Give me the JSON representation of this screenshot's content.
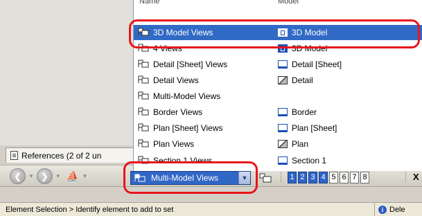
{
  "dropdown": {
    "header_name": "Name",
    "header_model": "Model",
    "rows": [
      {
        "name": "3D Model Views",
        "model": "3D Model",
        "model_icon": "3d-model-icon"
      },
      {
        "name": "4 Views",
        "model": "3D Model",
        "model_icon": "3d-model-icon"
      },
      {
        "name": "Detail [Sheet] Views",
        "model": "Detail [Sheet]",
        "model_icon": "sheet-icon"
      },
      {
        "name": "Detail Views",
        "model": "Detail",
        "model_icon": "detail-icon"
      },
      {
        "name": "Multi-Model Views",
        "model": "",
        "model_icon": ""
      },
      {
        "name": "Border Views",
        "model": "Border",
        "model_icon": "sheet-icon"
      },
      {
        "name": "Plan [Sheet] Views",
        "model": "Plan [Sheet]",
        "model_icon": "sheet-icon"
      },
      {
        "name": "Plan Views",
        "model": "Plan",
        "model_icon": "detail-icon"
      },
      {
        "name": "Section 1 Views",
        "model": "Section 1",
        "model_icon": "sheet-icon"
      }
    ],
    "selected_index": 0
  },
  "references_tab": {
    "label": "References (2 of 2 un"
  },
  "toolbar": {
    "view_combo": {
      "value": "Multi-Model Views"
    },
    "back_glyph": "❮",
    "forward_glyph": "❯",
    "view_numbers": [
      "1",
      "2",
      "3",
      "4",
      "5",
      "6",
      "7",
      "8"
    ],
    "active_views": [
      "1",
      "2",
      "3",
      "4"
    ],
    "close_glyph": "X"
  },
  "status_bar": {
    "message": "Element Selection > Identify element to add to set",
    "right_text": "Dele",
    "info_glyph": "i"
  },
  "colors": {
    "selection": "#316ac5",
    "highlight_ring": "#e8151b"
  }
}
